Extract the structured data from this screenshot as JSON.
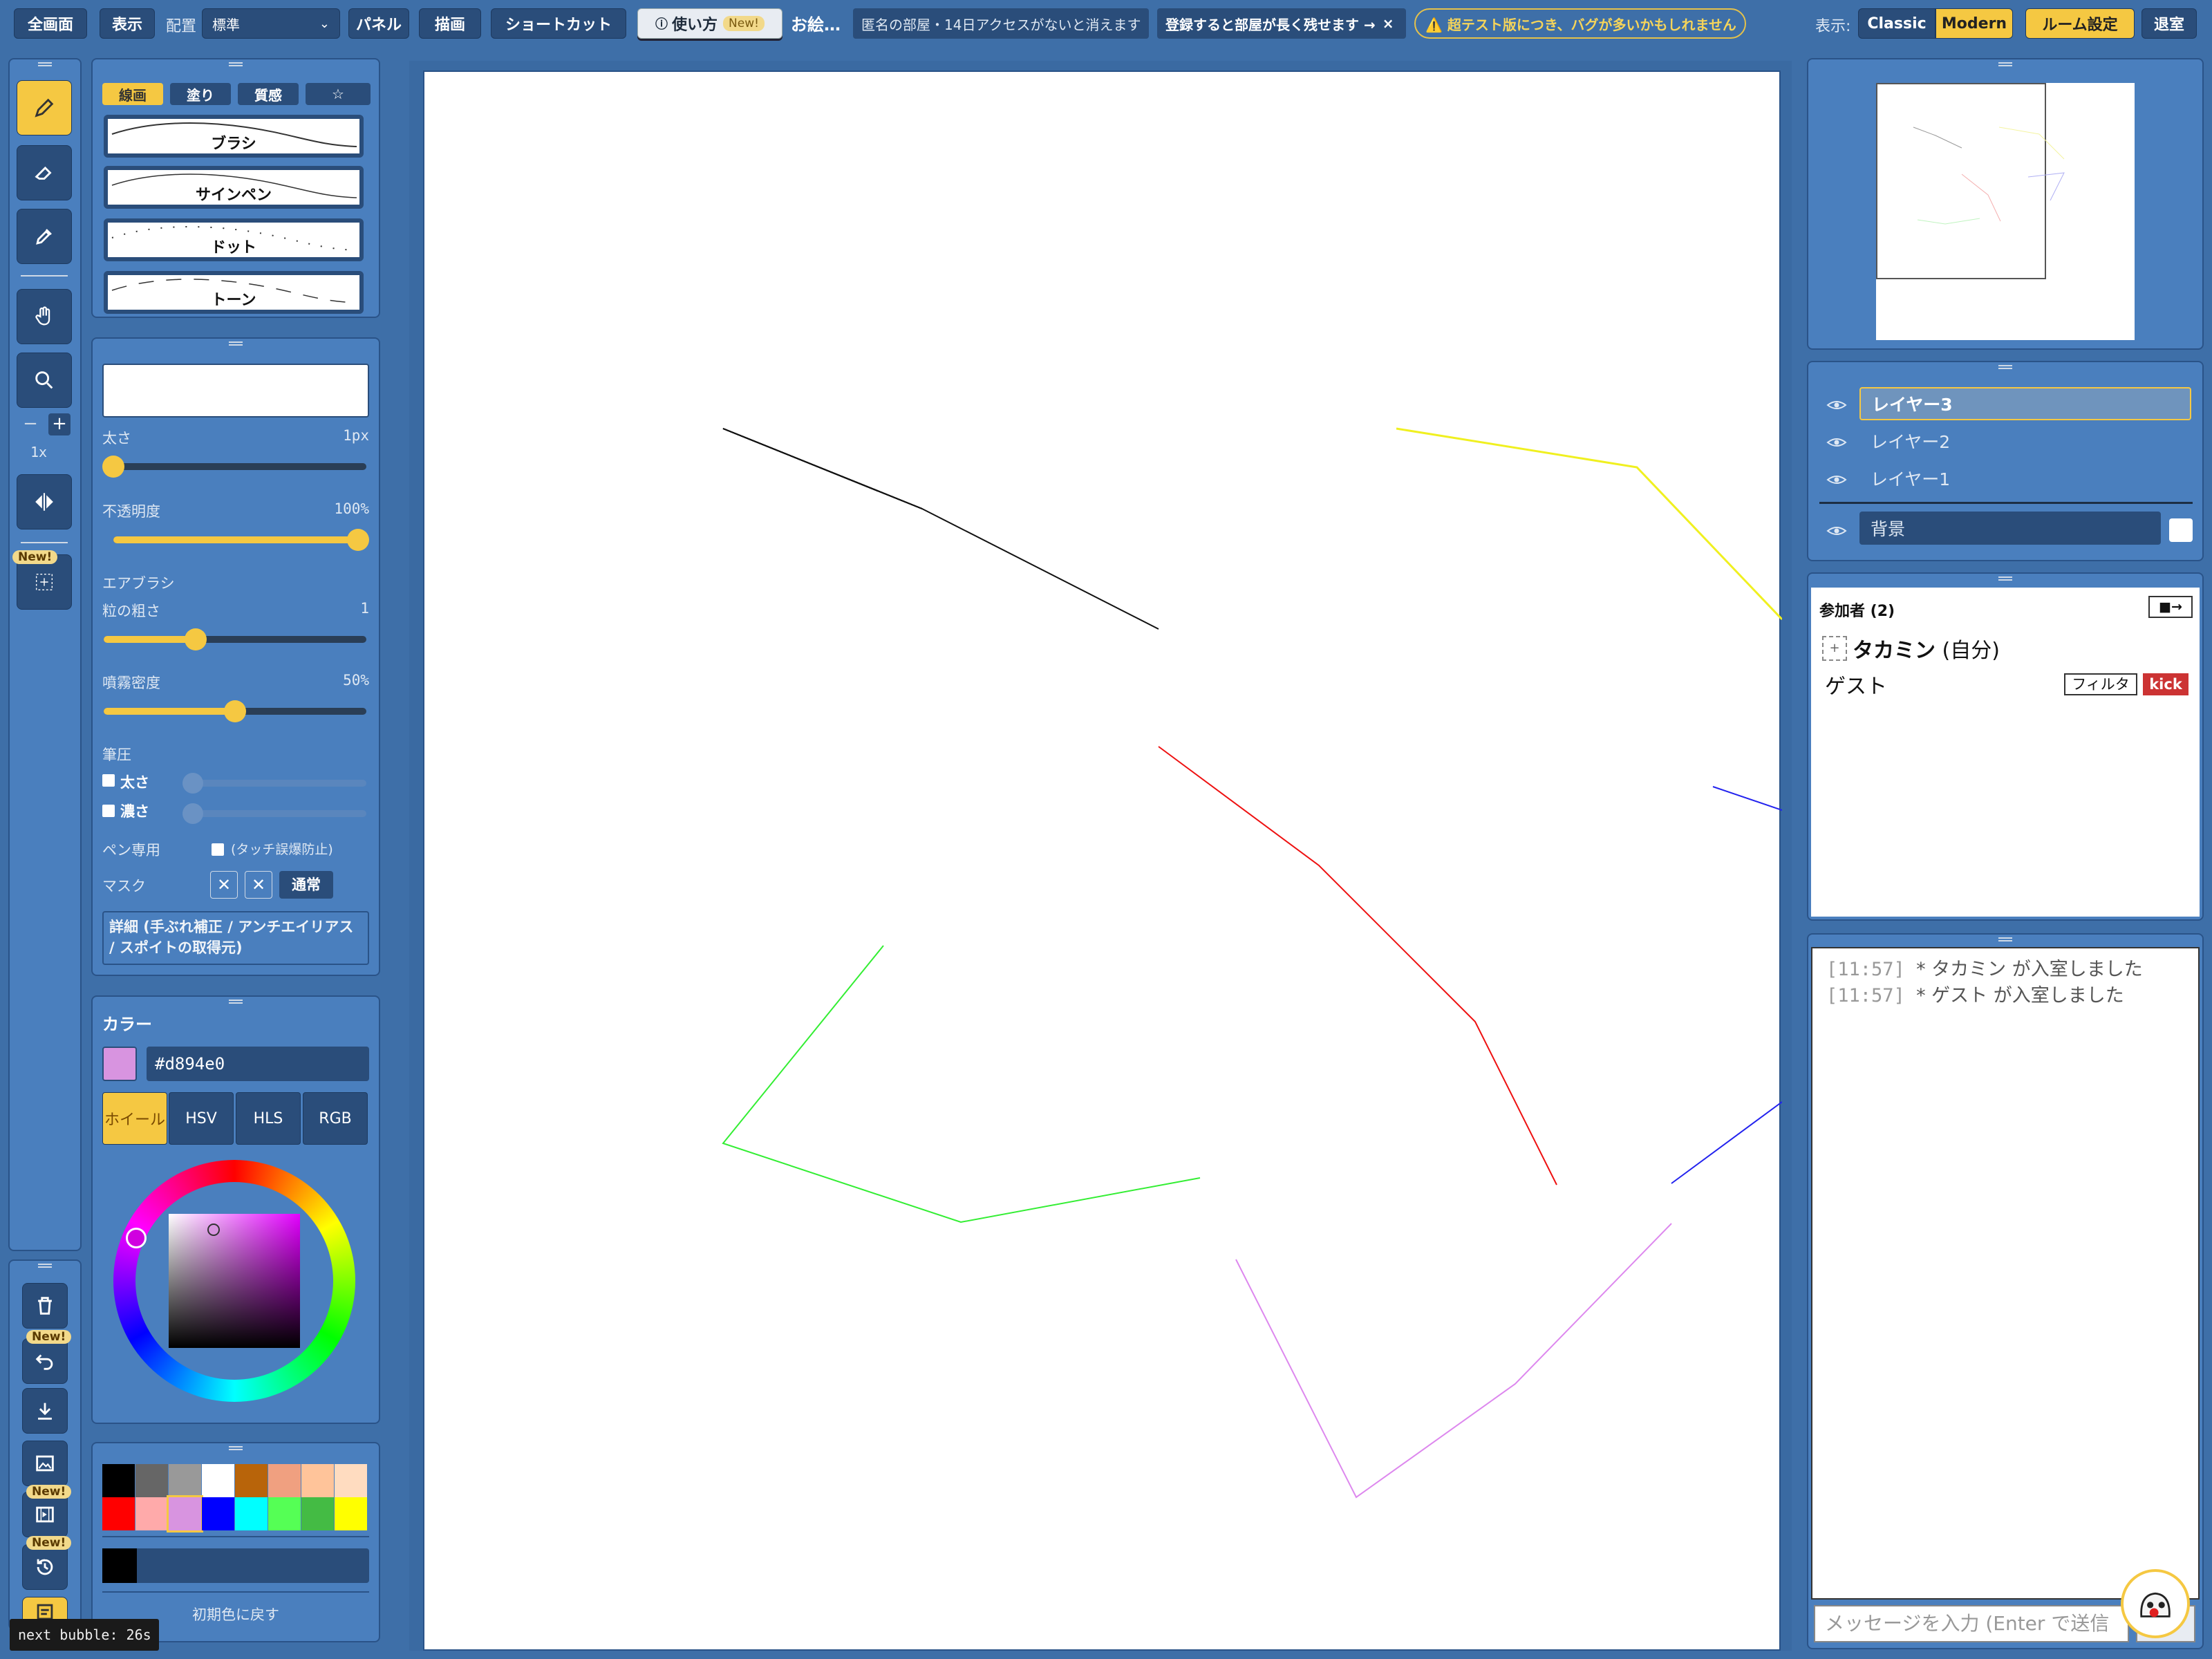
{
  "topbar": {
    "fullscreen": "全画面",
    "view": "表示",
    "layout_label": "配置",
    "layout_value": "標準",
    "panel": "パネル",
    "draw": "描画",
    "shortcut": "ショートカット",
    "howto": "使い方",
    "howto_new": "New!",
    "oekaki": "お絵…",
    "anon_notice": "匿名の部屋・14日アクセスがないと消えます",
    "register": "登録すると部屋が長く残せます →",
    "register_close": "×",
    "beta_warning": "⚠️ 超テスト版につき、バグが多いかもしれません",
    "display_label": "表示:",
    "classic": "Classic",
    "modern": "Modern",
    "room_settings": "ルーム設定",
    "exit": "退室"
  },
  "tools": {
    "zoom_level": "1x",
    "new1": "New!",
    "new2": "New!",
    "new3": "New!",
    "new4": "New!"
  },
  "brush_tabs": [
    "線画",
    "塗り",
    "質感",
    "☆"
  ],
  "brushes": [
    "ブラシ",
    "サインペン",
    "ドット",
    "トーン"
  ],
  "settings": {
    "size_label": "太さ",
    "size_value": "1px",
    "opacity_label": "不透明度",
    "opacity_value": "100%",
    "airbrush_label": "エアブラシ",
    "grain_label": "粒の粗さ",
    "grain_value": "1",
    "density_label": "噴霧密度",
    "density_value": "50%",
    "pressure_label": "筆圧",
    "pressure_size": "太さ",
    "pressure_depth": "濃さ",
    "pen_only_label": "ペン専用",
    "pen_only_note": "(タッチ誤爆防止)",
    "mask_label": "マスク",
    "mask_normal": "通常",
    "detail": "詳細 (手ぶれ補正 / アンチエイリアス / スポイトの取得元)",
    "size_fraction": 0.0,
    "opacity_fraction": 1.0,
    "grain_fraction": 0.35,
    "density_fraction": 0.5
  },
  "color": {
    "title": "カラー",
    "hex": "#d894e0",
    "current": "#d894e0",
    "tabs": [
      "ホイール",
      "HSV",
      "HLS",
      "RGB"
    ]
  },
  "palette": {
    "row1": [
      "#000000",
      "#666666",
      "#999999",
      "#ffffff",
      "#b8640a",
      "#f0a080",
      "#ffc49a",
      "#ffdcc0"
    ],
    "row2": [
      "#ff0000",
      "#ffaaaa",
      "#d894e0",
      "#0000ff",
      "#00ffff",
      "#55ff55",
      "#44bb44",
      "#ffff00"
    ],
    "reset": "初期色に戻す"
  },
  "layers": {
    "items": [
      "レイヤー3",
      "レイヤー2",
      "レイヤー1"
    ],
    "background": "背景"
  },
  "participants": {
    "title": "参加者 (2)",
    "me_name": "タカミン",
    "me_suffix": "(自分)",
    "guest": "ゲスト",
    "filter": "フィルタ",
    "kick": "kick",
    "exit_icon": "■→"
  },
  "chat": {
    "lines": [
      [
        "[11:57]",
        "* タカミン が入室しました"
      ],
      [
        "[11:57]",
        "* ゲスト が入室しました"
      ]
    ],
    "placeholder": "メッセージを入力 (Enter で送信"
  },
  "status": {
    "next_bubble": "next bubble: 26s"
  },
  "colors": {
    "accent": "#f5c842",
    "panel": "#4a7fbe",
    "dark": "#2a4d7a",
    "kick": "#cc3333"
  }
}
